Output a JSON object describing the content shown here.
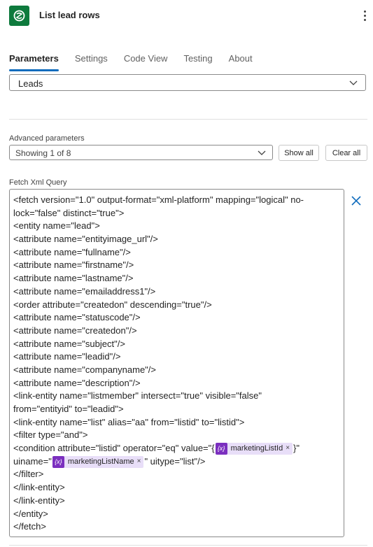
{
  "header": {
    "title": "List lead rows",
    "app_icon": "dataverse-icon",
    "menu_icon": "more-vertical-icon"
  },
  "tabs": [
    {
      "label": "Parameters",
      "active": true
    },
    {
      "label": "Settings",
      "active": false
    },
    {
      "label": "Code View",
      "active": false
    },
    {
      "label": "Testing",
      "active": false
    },
    {
      "label": "About",
      "active": false
    }
  ],
  "table_select": {
    "value": "Leads"
  },
  "advanced": {
    "label": "Advanced parameters",
    "dropdown_value": "Showing 1 of 8",
    "show_all_label": "Show all",
    "clear_all_label": "Clear all"
  },
  "fetch_xml": {
    "label": "Fetch Xml Query",
    "lines": [
      "<fetch version=\"1.0\" output-format=\"xml-platform\" mapping=\"logical\" no-",
      "lock=\"false\" distinct=\"true\">",
      "<entity name=\"lead\">",
      "<attribute name=\"entityimage_url\"/>",
      "<attribute name=\"fullname\"/>",
      "<attribute name=\"firstname\"/>",
      "<attribute name=\"lastname\"/>",
      "<attribute name=\"emailaddress1\"/>",
      "<order attribute=\"createdon\" descending=\"true\"/>",
      "<attribute name=\"statuscode\"/>",
      "<attribute name=\"createdon\"/>",
      "<attribute name=\"subject\"/>",
      "<attribute name=\"leadid\"/>",
      "<attribute name=\"companyname\"/>",
      "<attribute name=\"description\"/>",
      "<link-entity name=\"listmember\" intersect=\"true\" visible=\"false\"",
      "from=\"entityid\" to=\"leadid\">",
      "<link-entity name=\"list\" alias=\"aa\" from=\"listid\" to=\"listid\">",
      "<filter type=\"and\">"
    ],
    "condition_prefix": "<condition attribute=\"listid\" operator=\"eq\" value=\"{",
    "token1": "marketingListId",
    "condition_suffix": "}\"",
    "uiname_prefix": "uiname=\"",
    "token2": "marketingListName",
    "uiname_suffix": "\" uitype=\"list\"/>",
    "closing_lines": [
      "</filter>",
      "</link-entity>",
      "</link-entity>",
      "</entity>",
      "</fetch>"
    ],
    "token_icon_text": "{x}",
    "token_remove": "×"
  },
  "colors": {
    "accent": "#0f6cbd",
    "app_icon_bg": "#0e7a3d",
    "token_bg": "#e8def8",
    "token_icon_bg": "#7b2fbf"
  }
}
